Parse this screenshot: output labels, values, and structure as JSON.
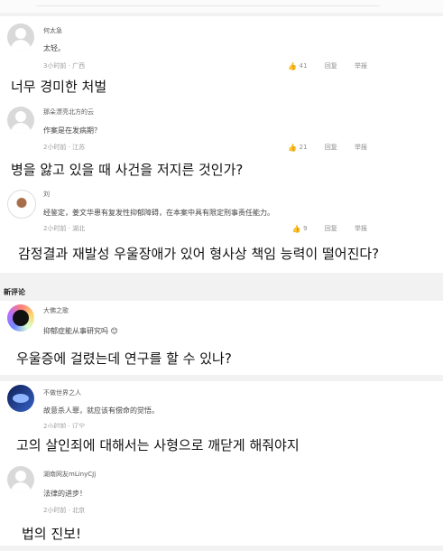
{
  "comments": [
    {
      "username": "何太急",
      "text": "太轻。",
      "meta": "3小时前 · 广西",
      "likes": "41",
      "reply": "回复",
      "report": "举报"
    },
    {
      "username": "那朵漂亮北方的云",
      "text": "作案是在发病期？",
      "meta": "2小时前 · 江苏",
      "likes": "21",
      "reply": "回复",
      "report": "举报"
    },
    {
      "username": "刘",
      "text": "经鉴定，姜文华患有复发性抑郁障碍，在本案中具有限定刑事责任能力。",
      "meta": "2小时前 · 湖北",
      "likes": "9",
      "reply": "回复",
      "report": "举报"
    },
    {
      "username": "大佛之歌",
      "text": "抑郁症能从事研究吗 😊",
      "meta": "",
      "likes": "",
      "reply": "",
      "report": ""
    },
    {
      "username": "不做世界之人",
      "text": "故意杀人罪，就应该有偿命的觉悟。",
      "meta": "2小时前 · 辽宁",
      "likes": "",
      "reply": "",
      "report": ""
    },
    {
      "username": "湖南网友mLinyCJj",
      "text": "法律的进步！",
      "meta": "2小时前 · 北京",
      "likes": "",
      "reply": "",
      "report": ""
    }
  ],
  "section_title": "新评论",
  "translations": [
    "너무 경미한 처벌",
    "병을 앓고 있을 때 사건을 저지른 것인가?",
    "감정결과 재발성 우울장애가 있어 형사상 책임 능력이 떨어진다?",
    "우울증에 걸렸는데 연구를 할 수 있나?",
    "고의 살인죄에 대해서는 사형으로 깨닫게 해줘야지",
    "법의 진보!"
  ],
  "icons": {
    "like": "thumbs-up-icon"
  }
}
